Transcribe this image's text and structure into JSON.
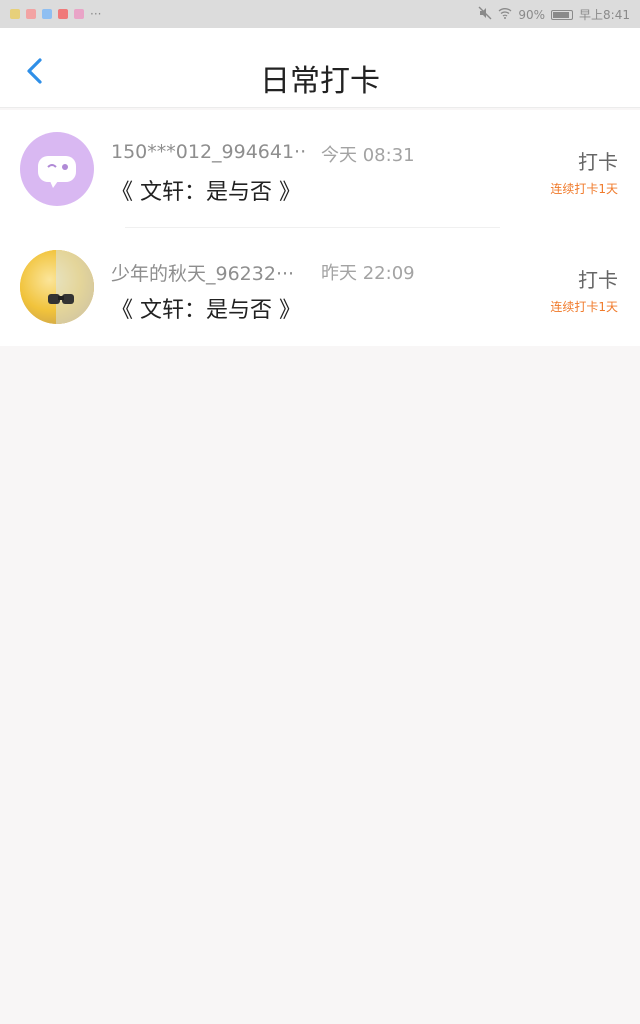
{
  "status_bar": {
    "battery": "90%",
    "time": "早上8:41"
  },
  "header": {
    "title": "日常打卡"
  },
  "checkins": [
    {
      "name": "150***012_994641··",
      "time": "今天 08:31",
      "title": "《 文轩：是与否 》",
      "action": "打卡",
      "streak": "连续打卡1天"
    },
    {
      "name": "少年的秋天_96232···",
      "time": "昨天 22:09",
      "title": "《 文轩：是与否 》",
      "action": "打卡",
      "streak": "连续打卡1天"
    }
  ],
  "colors": {
    "accent": "#2f8fe8",
    "streak": "#f07a2b"
  },
  "icons": {
    "back": "chevron-left-icon"
  }
}
